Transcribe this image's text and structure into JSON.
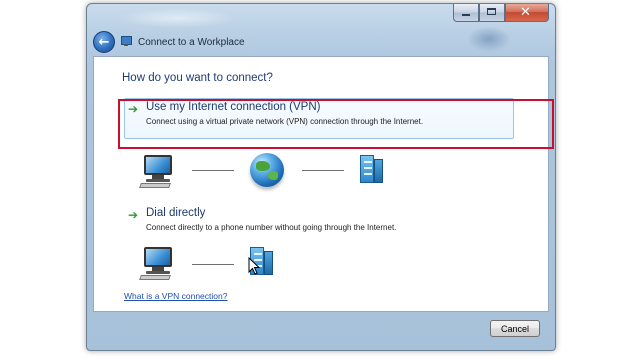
{
  "window": {
    "title": "Connect to a Workplace",
    "caption_buttons": [
      "minimize",
      "maximize",
      "close"
    ]
  },
  "icons": {
    "back": "back-arrow-icon",
    "app": "network-icon",
    "option_arrow": "green-arrow-icon"
  },
  "content": {
    "heading": "How do you want to connect?",
    "options": [
      {
        "title": "Use my Internet connection (VPN)",
        "description": "Connect using a virtual private network (VPN) connection through the Internet.",
        "highlighted": true
      },
      {
        "title": "Dial directly",
        "description": "Connect directly to a phone number without going through the Internet.",
        "highlighted": false
      }
    ],
    "help_link": "What is a VPN connection?"
  },
  "footer": {
    "cancel_label": "Cancel"
  },
  "colors": {
    "highlight_border": "#c8102e",
    "heading_text": "#1e3c78",
    "link": "#1f4fb0",
    "arrow": "#2e9b2e"
  }
}
